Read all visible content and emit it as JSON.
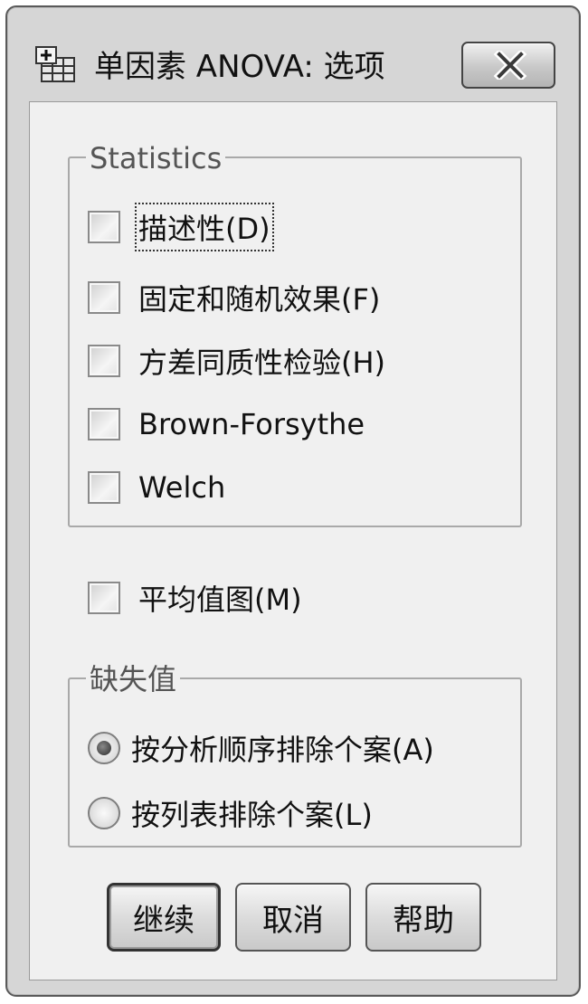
{
  "window": {
    "title": "单因素 ANOVA: 选项",
    "close_icon": "close-icon",
    "app_icon": "spss-table-icon"
  },
  "statistics": {
    "legend": "Statistics",
    "items": [
      {
        "label": "描述性(D)",
        "checked": false,
        "focused": true
      },
      {
        "label": "固定和随机效果(F)",
        "checked": false
      },
      {
        "label": "方差同质性检验(H)",
        "checked": false
      },
      {
        "label": "Brown-Forsythe",
        "checked": false
      },
      {
        "label": "Welch",
        "checked": false
      }
    ]
  },
  "means_plot": {
    "label": "平均值图(M)",
    "checked": false
  },
  "missing": {
    "legend": "缺失值",
    "options": [
      {
        "label": "按分析顺序排除个案(A)",
        "selected": true
      },
      {
        "label": "按列表排除个案(L)",
        "selected": false
      }
    ]
  },
  "buttons": {
    "continue": "继续",
    "cancel": "取消",
    "help": "帮助"
  }
}
